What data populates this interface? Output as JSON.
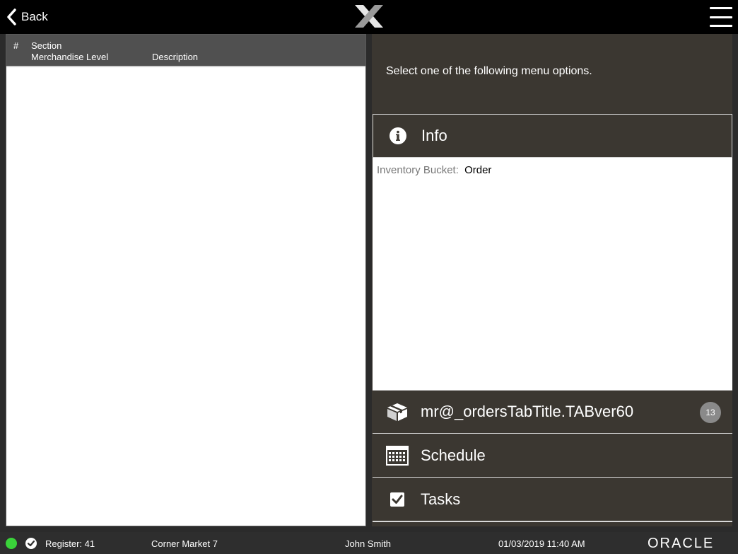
{
  "topbar": {
    "back_label": "Back",
    "back_icon": "chevron-left-icon",
    "logo_icon": "x-logo-icon",
    "menu_icon": "hamburger-menu-icon"
  },
  "table": {
    "headers": {
      "number": "#",
      "section": "Section",
      "merchandise_level": "Merchandise Level",
      "description": "Description"
    },
    "rows": []
  },
  "right_panel": {
    "prompt": "Select one of the following menu options.",
    "info": {
      "label": "Info",
      "icon": "info-icon",
      "fields": [
        {
          "key": "Inventory Bucket:",
          "value": "Order"
        }
      ]
    },
    "menu_items": [
      {
        "label": "mr@_ordersTabTitle.TABver60",
        "icon": "box-icon",
        "badge": "13"
      },
      {
        "label": "Schedule",
        "icon": "calendar-icon"
      },
      {
        "label": "Tasks",
        "icon": "checkbox-icon"
      }
    ]
  },
  "statusbar": {
    "connection_status_color": "#3ad33a",
    "register": "Register: 41",
    "store": "Corner Market 7",
    "user": "John Smith",
    "datetime": "01/03/2019 11:40 AM",
    "vendor_logo": "ORACLE"
  },
  "colors": {
    "panel_bg": "#3b3731",
    "header_bg": "#505050",
    "topbar_bg": "#000000"
  }
}
